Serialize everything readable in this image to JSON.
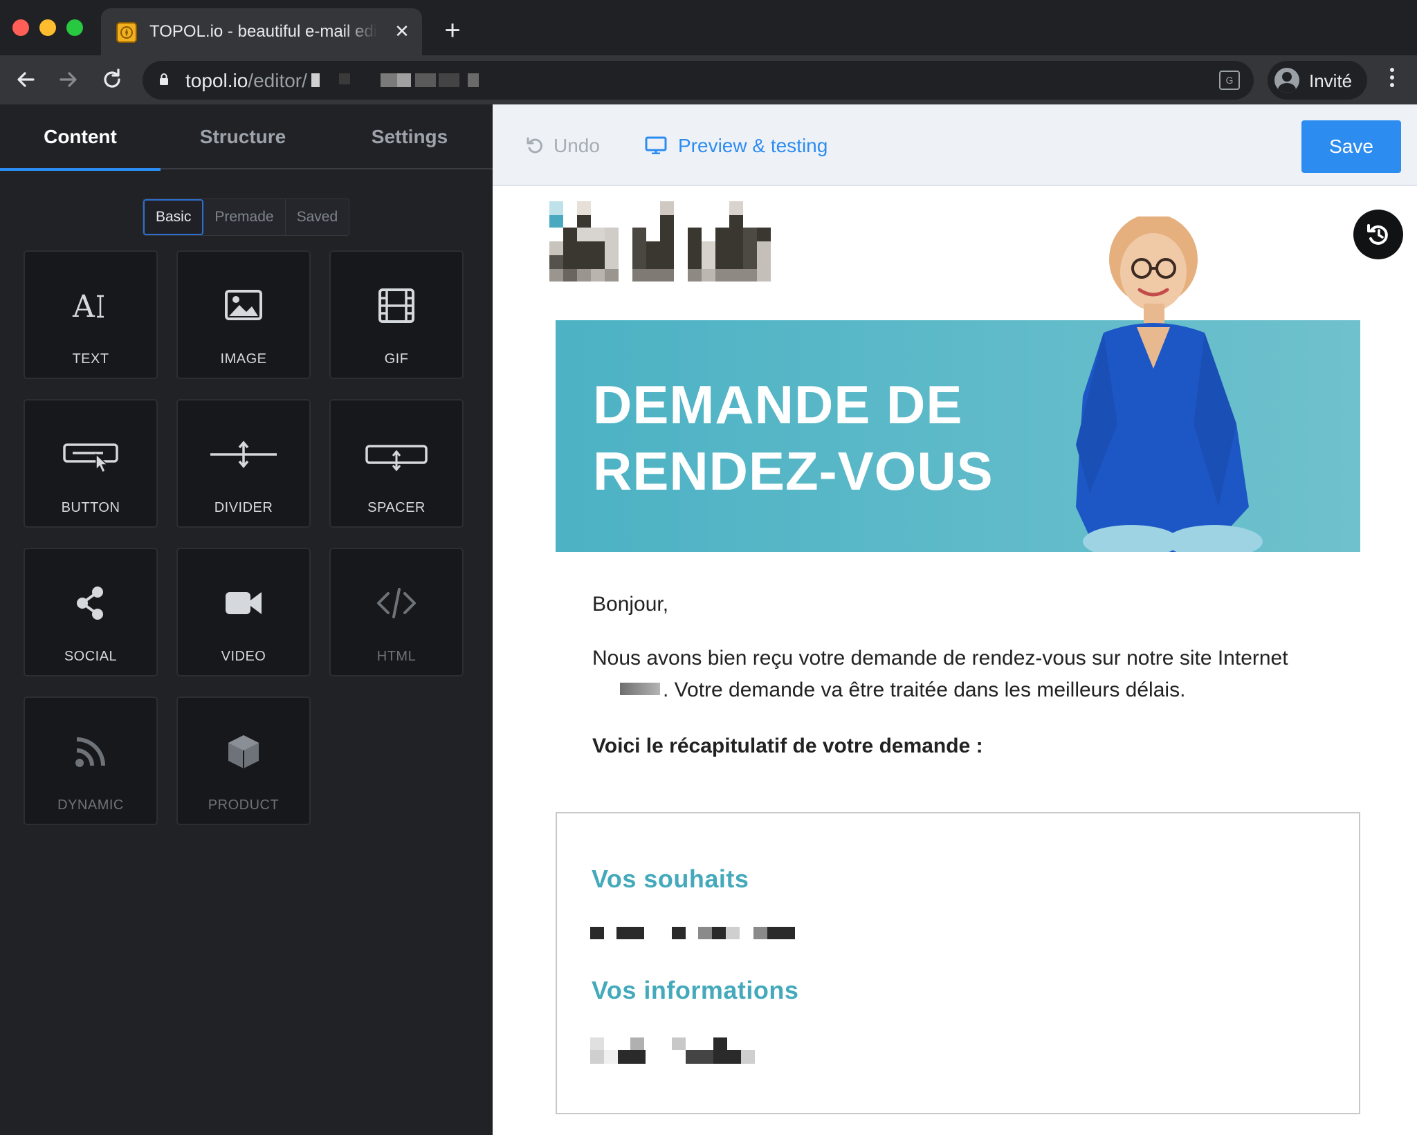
{
  "browser": {
    "tab_title": "TOPOL.io - beautiful e-mail editor",
    "tab_close": "✕",
    "new_tab": "+",
    "url_host": "topol.io",
    "url_path": "/editor/",
    "profile_name": "Invité"
  },
  "sidebar": {
    "tabs": [
      "Content",
      "Structure",
      "Settings"
    ],
    "active_tab": "Content",
    "subtabs": [
      "Basic",
      "Premade",
      "Saved"
    ],
    "active_subtab": "Basic",
    "blocks": [
      {
        "label": "TEXT",
        "icon": "text-icon"
      },
      {
        "label": "IMAGE",
        "icon": "image-icon"
      },
      {
        "label": "GIF",
        "icon": "gif-film-icon"
      },
      {
        "label": "BUTTON",
        "icon": "button-icon"
      },
      {
        "label": "DIVIDER",
        "icon": "divider-icon"
      },
      {
        "label": "SPACER",
        "icon": "spacer-icon"
      },
      {
        "label": "SOCIAL",
        "icon": "share-icon"
      },
      {
        "label": "VIDEO",
        "icon": "video-camera-icon"
      },
      {
        "label": "HTML",
        "icon": "code-icon"
      },
      {
        "label": "DYNAMIC",
        "icon": "rss-icon"
      },
      {
        "label": "PRODUCT",
        "icon": "box-icon"
      }
    ]
  },
  "editor": {
    "undo_label": "Undo",
    "preview_label": "Preview & testing",
    "save_label": "Save"
  },
  "email": {
    "banner_title": "DEMANDE DE\nRENDEZ-VOUS",
    "greeting": "Bonjour,",
    "paragraph_part1": "Nous avons bien reçu votre demande de rendez-vous sur notre site Internet",
    "paragraph_part2": ". Votre demande va être traitée dans les meilleurs délais.",
    "summary_intro": "Voici le récapitulatif de votre demande :",
    "section_wishes": "Vos souhaits",
    "section_info": "Vos informations"
  },
  "colors": {
    "accent_blue": "#2d8cf0",
    "banner_teal": "#4cb2c4",
    "heading_teal": "#44a9bb"
  }
}
